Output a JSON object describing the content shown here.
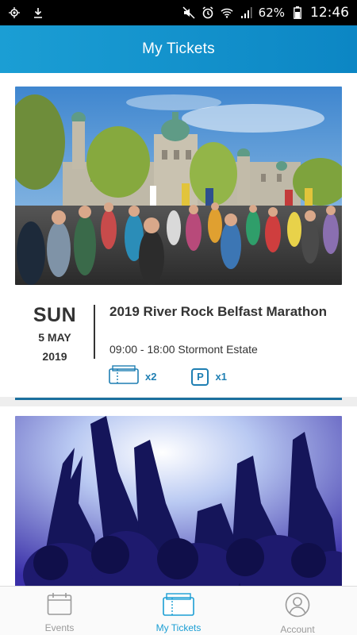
{
  "status_bar": {
    "left_icons": [
      "location-icon",
      "download-icon"
    ],
    "right_icons": [
      "mute-icon",
      "alarm-icon",
      "wifi-icon",
      "signal-icon",
      "battery-icon"
    ],
    "battery": "62%",
    "time": "12:46"
  },
  "header": {
    "title": "My Tickets"
  },
  "tickets": [
    {
      "day_of_week": "SUN",
      "day_month": "5 MAY",
      "year": "2019",
      "title": "2019 River Rock Belfast Marathon",
      "time_location": "09:00 - 18:00 Stormont Estate",
      "ticket_count": "x2",
      "parking_label": "P",
      "parking_count": "x1",
      "image": "marathon-runners-photo"
    },
    {
      "image": "concert-crowd-photo"
    }
  ],
  "bottom_nav": {
    "items": [
      {
        "label": "Events",
        "icon": "calendar-icon",
        "active": false
      },
      {
        "label": "My Tickets",
        "icon": "ticket-icon",
        "active": true
      },
      {
        "label": "Account",
        "icon": "account-icon",
        "active": false
      }
    ]
  },
  "colors": {
    "primary": "#1b9ed4",
    "accent": "#1f7fb3",
    "text": "#333333",
    "inactive": "#9a9a9a"
  }
}
